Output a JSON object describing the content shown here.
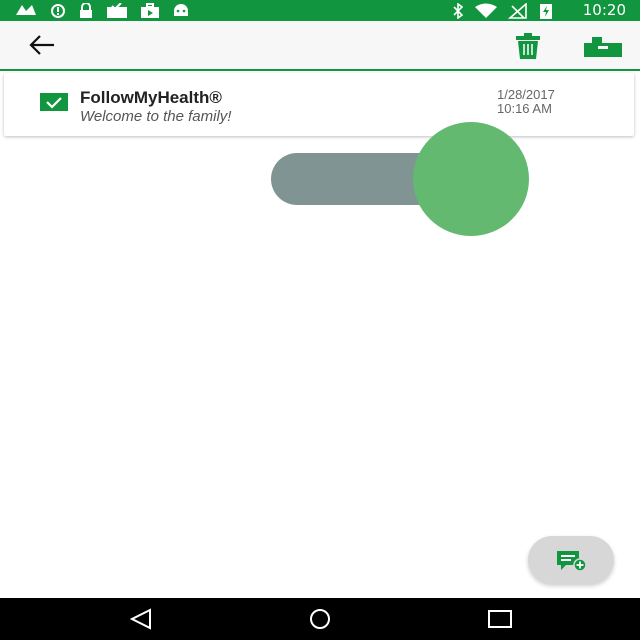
{
  "status_bar": {
    "time": "10:20",
    "left_icons": [
      "fax-icon",
      "alert-circle-icon",
      "lock-icon",
      "mail-check-icon",
      "briefcase-play-icon",
      "android-icon"
    ],
    "right_icons": [
      "bluetooth-icon",
      "wifi-icon",
      "no-signal-icon",
      "battery-charging-icon"
    ]
  },
  "app_bar": {
    "icons": [
      "back-arrow-icon",
      "trash-icon",
      "archive-icon"
    ]
  },
  "message": {
    "sender": "FollowMyHealth®",
    "subject": "Welcome to the family!",
    "date": "1/28/2017",
    "time": "10:16 AM",
    "checked": true
  },
  "toggle": {
    "state": "on"
  },
  "fab": {
    "icon": "compose-message-icon"
  },
  "nav_bar": {
    "icons": [
      "back-triangle-icon",
      "home-circle-icon",
      "recents-square-icon"
    ]
  },
  "colors": {
    "primary": "#11963f",
    "toggle_track": "#809593",
    "toggle_knob": "#63b96f"
  }
}
